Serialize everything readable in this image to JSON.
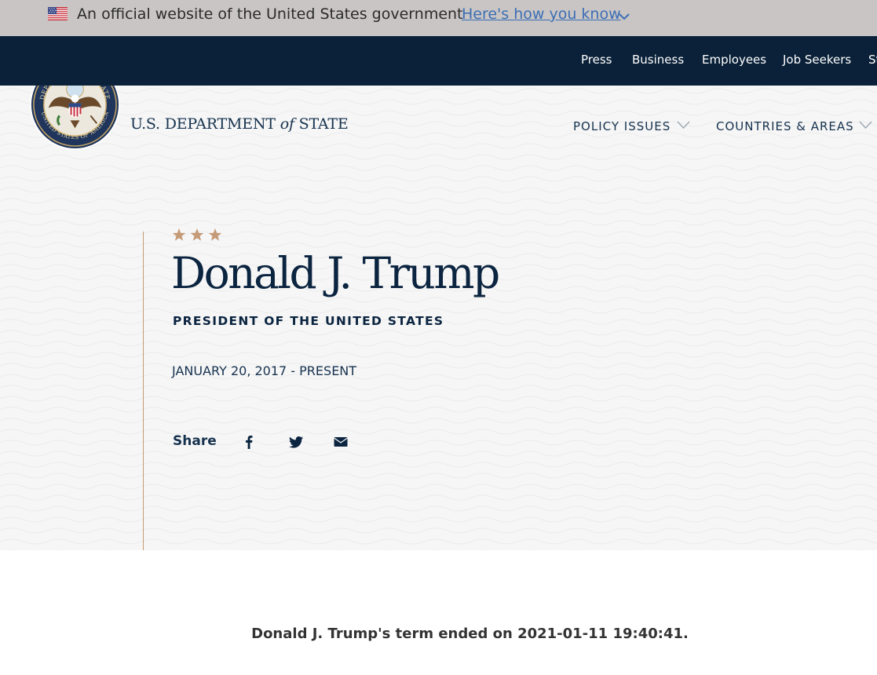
{
  "gov_banner": {
    "text": "An official website of the United States government",
    "link_label": "Here's how you know"
  },
  "utility_nav": {
    "items": [
      "Press",
      "Business",
      "Employees",
      "Job Seekers",
      "St"
    ]
  },
  "header": {
    "wordmark_part1": "U.S. DEPARTMENT",
    "wordmark_of": "of",
    "wordmark_part2": "STATE",
    "seal_text_top": "DEPARTMENT OF STATE",
    "seal_text_bottom": "UNITED STATES OF AMERICA"
  },
  "main_nav": {
    "items": [
      "POLICY ISSUES",
      "COUNTRIES & AREAS"
    ]
  },
  "hero": {
    "stars": "★ ★ ★",
    "name": "Donald J. Trump",
    "role": "PRESIDENT OF THE UNITED STATES",
    "term": "JANUARY 20, 2017 - PRESENT",
    "share_label": "Share",
    "share_icons": [
      "facebook-icon",
      "twitter-icon",
      "email-icon"
    ]
  },
  "notice": {
    "text": "Donald J. Trump's term ended on 2021-01-11 19:40:41."
  },
  "colors": {
    "banner_bg": "#c9c5c4",
    "utility_bg": "#0a2139",
    "navy": "#0b2440",
    "gold": "#c49a77",
    "link_blue": "#3c6eb4"
  }
}
